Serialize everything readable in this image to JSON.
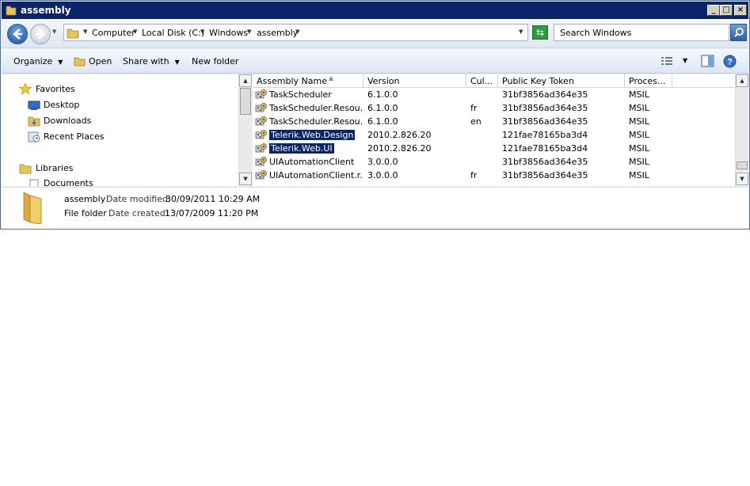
{
  "window": {
    "title": "assembly"
  },
  "titlebar_buttons": {
    "minimize": "_",
    "maximize": "□",
    "close": "×"
  },
  "address": {
    "crumbs": [
      "Computer",
      "Local Disk (C:)",
      "Windows",
      "assembly"
    ]
  },
  "search": {
    "placeholder": "Search Windows"
  },
  "toolbar": {
    "organize": "Organize",
    "open": "Open",
    "share_with": "Share with",
    "new_folder": "New folder"
  },
  "nav": {
    "favorites": "Favorites",
    "desktop": "Desktop",
    "downloads": "Downloads",
    "recent_places": "Recent Places",
    "libraries": "Libraries",
    "documents": "Documents"
  },
  "columns": {
    "name": "Assembly Name",
    "version": "Version",
    "culture": "Cul...",
    "token": "Public Key Token",
    "processor": "Proces..."
  },
  "rows": [
    {
      "name": "TaskScheduler",
      "version": "6.1.0.0",
      "culture": "",
      "token": "31bf3856ad364e35",
      "processor": "MSIL"
    },
    {
      "name": "TaskScheduler.Resou...",
      "version": "6.1.0.0",
      "culture": "fr",
      "token": "31bf3856ad364e35",
      "processor": "MSIL"
    },
    {
      "name": "TaskScheduler.Resou...",
      "version": "6.1.0.0",
      "culture": "en",
      "token": "31bf3856ad364e35",
      "processor": "MSIL"
    },
    {
      "name": "Telerik.Web.Design",
      "version": "2010.2.826.20",
      "culture": "",
      "token": "121fae78165ba3d4",
      "processor": "MSIL"
    },
    {
      "name": "Telerik.Web.UI",
      "version": "2010.2.826.20",
      "culture": "",
      "token": "121fae78165ba3d4",
      "processor": "MSIL"
    },
    {
      "name": "UIAutomationClient",
      "version": "3.0.0.0",
      "culture": "",
      "token": "31bf3856ad364e35",
      "processor": "MSIL"
    },
    {
      "name": "UIAutomationClient.r...",
      "version": "3.0.0.0",
      "culture": "fr",
      "token": "31bf3856ad364e35",
      "processor": "MSIL"
    }
  ],
  "selected_rows": [
    3,
    4
  ],
  "details": {
    "name": "assembly",
    "modified_label": "Date modified:",
    "modified": "30/09/2011 10:29 AM",
    "type": "File folder",
    "created_label": "Date created:",
    "created": "13/07/2009 11:20 PM"
  },
  "colors": {
    "title_bar": "#0a246a",
    "selection": "#0a246a",
    "folder": "#e8c25a"
  }
}
